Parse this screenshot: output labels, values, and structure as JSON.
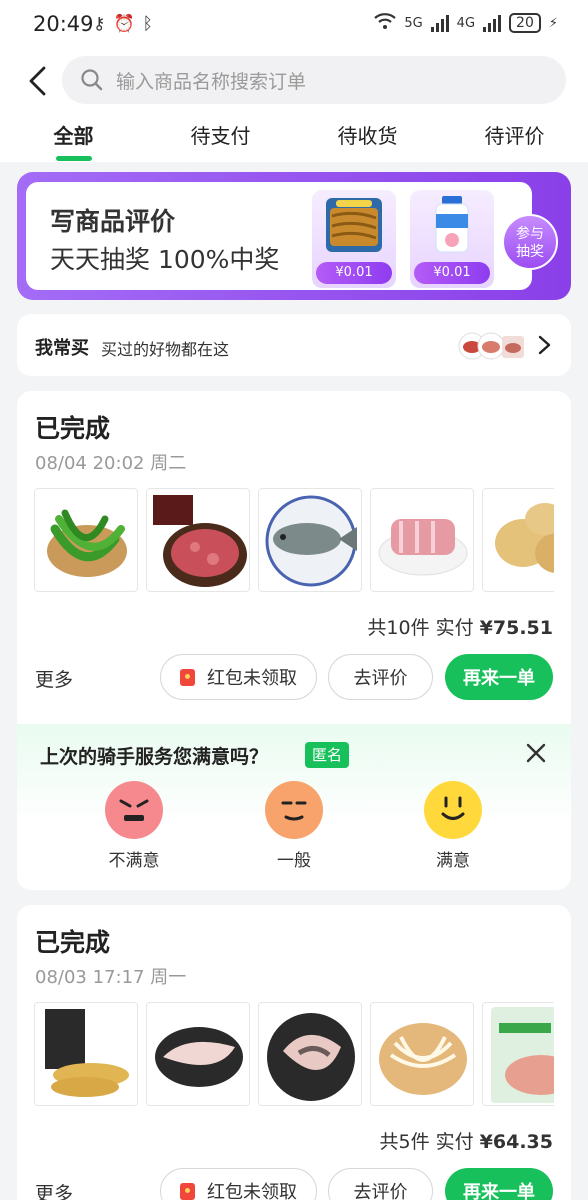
{
  "status_bar": {
    "time": "20:49",
    "net5g": "5G",
    "net4g": "4G",
    "battery": "20"
  },
  "search": {
    "placeholder": "输入商品名称搜索订单"
  },
  "tabs": [
    {
      "label": "全部",
      "active": true
    },
    {
      "label": "待支付",
      "active": false
    },
    {
      "label": "待收货",
      "active": false
    },
    {
      "label": "待评价",
      "active": false
    }
  ],
  "banner": {
    "title": "写商品评价",
    "subtitle": "天天抽奖 100%中奖",
    "prize1_price": "¥0.01",
    "prize2_price": "¥0.01",
    "join_line1": "参与",
    "join_line2": "抽奖",
    "accent": "#9b4cf0"
  },
  "frequent": {
    "title": "我常买",
    "subtitle": "买过的好物都在这"
  },
  "orders": [
    {
      "status": "已完成",
      "date": "08/04 20:02 周二",
      "summary_prefix": "共10件 实付 ",
      "amount": "¥75.51",
      "more": "更多",
      "red_packet": "红包未领取",
      "review": "去评价",
      "reorder": "再来一单",
      "items": [
        "青椒",
        "牛肉粒",
        "鱼",
        "排骨",
        "土豆"
      ]
    },
    {
      "status": "已完成",
      "date": "08/03 17:17 周一",
      "summary_prefix": "共5件 实付 ",
      "amount": "¥64.35",
      "more": "更多",
      "red_packet": "红包未领取",
      "review": "去评价",
      "reorder": "再来一单",
      "items": [
        "黄鱼",
        "鱼片",
        "鱼头",
        "豆芽",
        "鸭肉"
      ]
    }
  ],
  "survey": {
    "question": "上次的骑手服务您满意吗？",
    "anon": "匿名",
    "options": [
      "不满意",
      "一般",
      "满意"
    ]
  },
  "colors": {
    "brand_green": "#17c05a",
    "page_bg": "#f3f4f6"
  }
}
